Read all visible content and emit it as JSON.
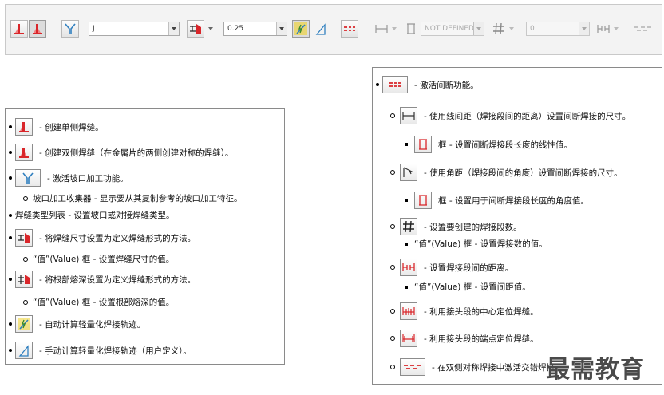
{
  "toolbar": {
    "weld_type_value": "J",
    "size_value": "0.25",
    "spacing_placeholder": "NOT DEFINED",
    "count_value": "0"
  },
  "left_panel": {
    "items": [
      {
        "text": "- 创建单侧焊缝。"
      },
      {
        "text": "- 创建双侧焊缝（在金属片的两侧创建对称的焊缝）。"
      },
      {
        "text": "- 激活坡口加工功能。"
      },
      {
        "text": "坡口加工收集器 - 显示要从其复制参考的坡口加工特征。"
      },
      {
        "text": "焊缝类型列表 - 设置坡口或对接焊缝类型。"
      },
      {
        "text": "- 将焊缝尺寸设置为定义焊缝形式的方法。"
      },
      {
        "text": "“值”(Value) 框 - 设置焊缝尺寸的值。"
      },
      {
        "text": "- 将根部熔深设置为定义焊缝形式的方法。"
      },
      {
        "text": "“值”(Value) 框 - 设置根部熔深的值。"
      },
      {
        "text": "- 自动计算轻量化焊接轨迹。"
      },
      {
        "text": "- 手动计算轻量化焊接轨迹（用户定义）。"
      }
    ]
  },
  "right_panel": {
    "items": [
      {
        "text": "- 激活间断功能。"
      },
      {
        "text": "- 使用线间距（焊接段间的距离）设置间断焊接的尺寸。"
      },
      {
        "text": "框 - 设置间断焊接段长度的线性值。"
      },
      {
        "text": "- 使用角距（焊接段间的角度）设置间断焊接的尺寸。"
      },
      {
        "text": "框 - 设置用于间断焊接段长度的角度值。"
      },
      {
        "text": "- 设置要创建的焊接段数。"
      },
      {
        "text": "“值”(Value) 框 - 设置焊接数的值。"
      },
      {
        "text": "- 设置焊接段间的距离。"
      },
      {
        "text": "“值”(Value) 框 - 设置间距值。"
      },
      {
        "text": "- 利用接头段的中心定位焊缝。"
      },
      {
        "text": "- 利用接头段的端点定位焊缝。"
      },
      {
        "text": "- 在双侧对称焊接中激活交错焊接"
      }
    ]
  },
  "watermark": "最需教育",
  "colors": {
    "accent_red": "#d9262a",
    "accent_blue": "#2f7fbf",
    "accent_yellow": "#f2d21a"
  }
}
